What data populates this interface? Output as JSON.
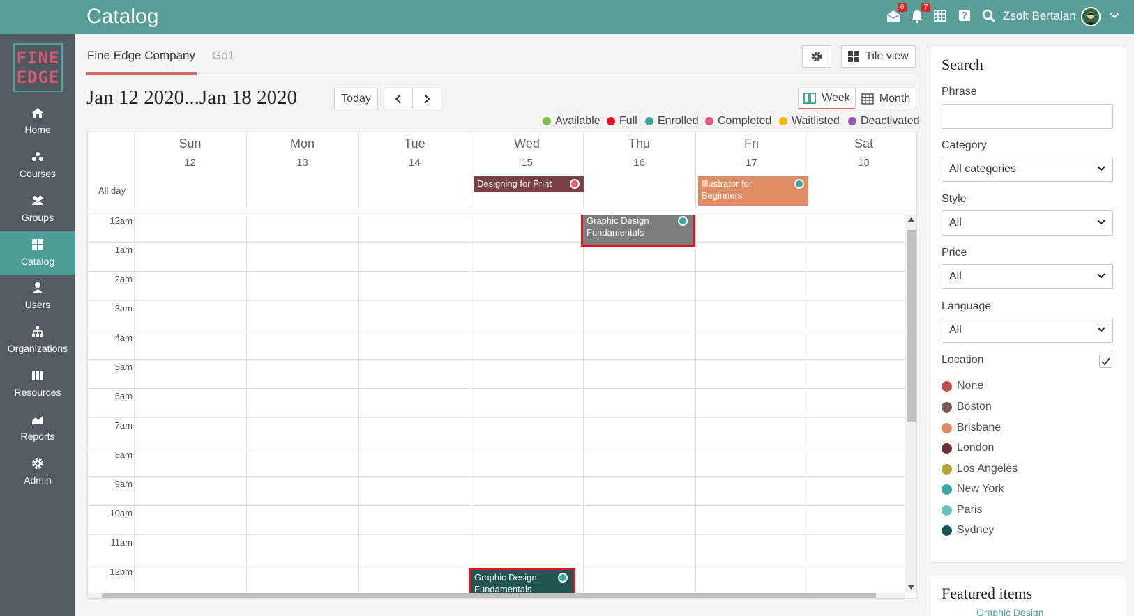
{
  "header": {
    "title": "Catalog",
    "messages_badge": "6",
    "notifications_badge": "7",
    "user_name": "Zsolt Bertalan",
    "icons": [
      "mail-icon",
      "bell-icon",
      "calendar-icon",
      "help-icon",
      "search-icon",
      "avatar",
      "chevron-down-icon"
    ]
  },
  "logo": {
    "line1": "FINE",
    "line2": "EDGE"
  },
  "sidebar": {
    "items": [
      {
        "label": "Home",
        "icon": "home-icon"
      },
      {
        "label": "Courses",
        "icon": "courses-icon"
      },
      {
        "label": "Groups",
        "icon": "groups-icon"
      },
      {
        "label": "Catalog",
        "icon": "catalog-icon",
        "active": true
      },
      {
        "label": "Users",
        "icon": "user-icon"
      },
      {
        "label": "Organizations",
        "icon": "org-icon"
      },
      {
        "label": "Resources",
        "icon": "resources-icon"
      },
      {
        "label": "Reports",
        "icon": "reports-icon"
      },
      {
        "label": "Admin",
        "icon": "gear-icon"
      }
    ]
  },
  "tabs": [
    {
      "label": "Fine Edge Company",
      "active": true
    },
    {
      "label": "Go1",
      "active": false
    }
  ],
  "toolbar": {
    "tile_view": "Tile view",
    "date_range": "Jan 12 2020...Jan 18 2020",
    "today": "Today",
    "week": "Week",
    "month": "Month"
  },
  "legend": [
    {
      "label": "Available",
      "color": "#7cc242"
    },
    {
      "label": "Full",
      "color": "#e8101a"
    },
    {
      "label": "Enrolled",
      "color": "#3aa6a0"
    },
    {
      "label": "Completed",
      "color": "#e8567a"
    },
    {
      "label": "Waitlisted",
      "color": "#f5b800"
    },
    {
      "label": "Deactivated",
      "color": "#9b59b6"
    }
  ],
  "calendar": {
    "all_day_label": "All day",
    "days": [
      {
        "name": "Sun",
        "date": "12"
      },
      {
        "name": "Mon",
        "date": "13"
      },
      {
        "name": "Tue",
        "date": "14"
      },
      {
        "name": "Wed",
        "date": "15"
      },
      {
        "name": "Thu",
        "date": "16"
      },
      {
        "name": "Fri",
        "date": "17"
      },
      {
        "name": "Sat",
        "date": "18"
      }
    ],
    "hours": [
      "12am",
      "1am",
      "2am",
      "3am",
      "4am",
      "5am",
      "6am",
      "7am",
      "8am",
      "9am",
      "10am",
      "11am",
      "12pm"
    ],
    "all_day_events": [
      {
        "title": "Designing for Print",
        "day": "Wed",
        "color": "#7a4146",
        "dot": "#e8567a"
      },
      {
        "title": "Illustrator for Beginners",
        "day": "Fri",
        "color": "#e08d66",
        "dot": "#3aa6a0"
      }
    ],
    "timed_events": [
      {
        "title": "Graphic Design Fundamentals",
        "day": "Thu",
        "start": "12am",
        "color": "#7d7d7d",
        "dot": "#3aa6a0",
        "highlighted": true
      },
      {
        "title": "Graphic Design Fundamentals",
        "day": "Wed",
        "start": "12pm",
        "color": "#1f5450",
        "dot": "#3aa6a0",
        "highlighted": true
      }
    ]
  },
  "search_panel": {
    "title": "Search",
    "phrase_label": "Phrase",
    "phrase_value": "",
    "category_label": "Category",
    "category_value": "All categories",
    "style_label": "Style",
    "style_value": "All",
    "price_label": "Price",
    "price_value": "All",
    "language_label": "Language",
    "language_value": "All",
    "location_label": "Location",
    "location_checked": true,
    "locations": [
      {
        "label": "None",
        "color": "#c0504d"
      },
      {
        "label": "Boston",
        "color": "#7a5858"
      },
      {
        "label": "Brisbane",
        "color": "#e08d66"
      },
      {
        "label": "London",
        "color": "#6e2e36"
      },
      {
        "label": "Los Angeles",
        "color": "#b7a13a"
      },
      {
        "label": "New York",
        "color": "#3aa6a0"
      },
      {
        "label": "Paris",
        "color": "#66c3c0"
      },
      {
        "label": "Sydney",
        "color": "#1f5450"
      }
    ]
  },
  "featured": {
    "title": "Featured items",
    "first_item": "Graphic Design"
  }
}
